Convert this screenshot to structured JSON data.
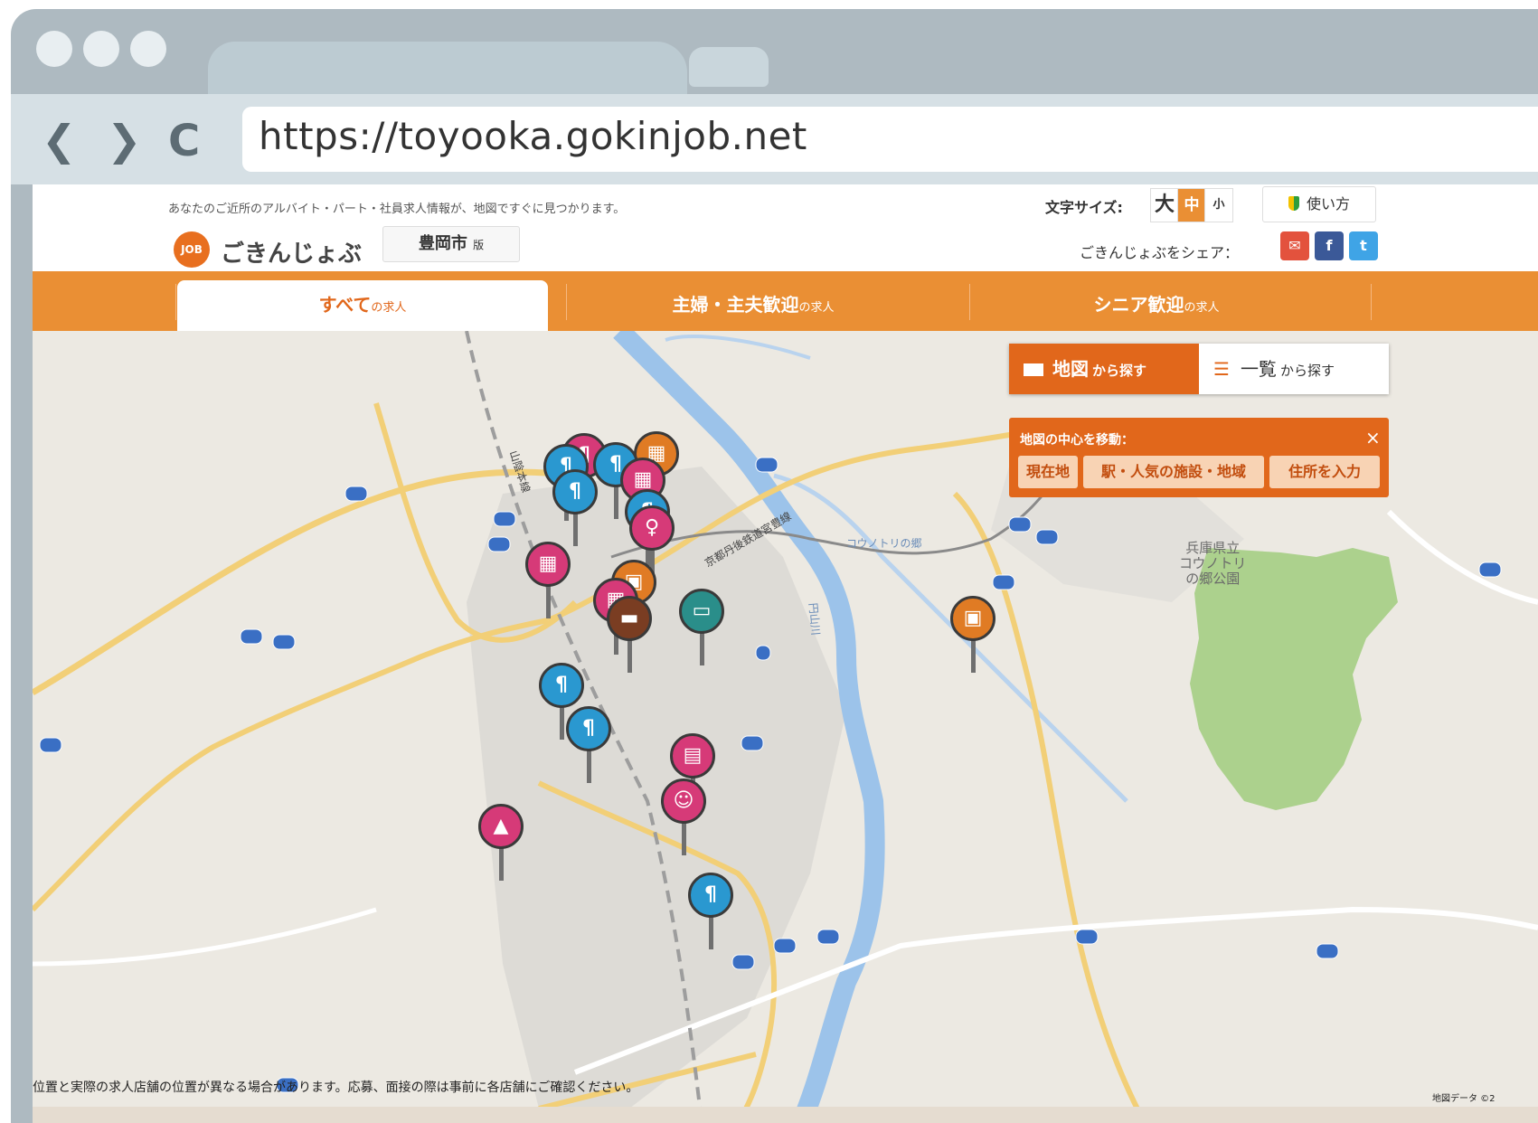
{
  "browser": {
    "url": "https://toyooka.gokinjob.net",
    "back_glyph": "❮",
    "forward_glyph": "❯",
    "reload_glyph": "C"
  },
  "header": {
    "tagline": "あなたのご近所のアルバイト・パート・社員求人情報が、地図ですぐに見つかります。",
    "logo_badge": "JOB",
    "logo_text": "ごきんじょぶ",
    "city": "豊岡市",
    "city_suffix": "版",
    "fontsize_label": "文字サイズ:",
    "fontsize_options": [
      "大",
      "中",
      "小"
    ],
    "howto_label": "使い方",
    "share_label": "ごきんじょぶをシェア：",
    "share_buttons": [
      "✉",
      "f",
      "t"
    ]
  },
  "nav": {
    "tabs": [
      {
        "label": "すべて",
        "suffix": "の求人"
      },
      {
        "label": "主婦・主夫歓迎",
        "suffix": "の求人"
      },
      {
        "label": "シニア歓迎",
        "suffix": "の求人"
      }
    ]
  },
  "map": {
    "mode_map": "地図",
    "mode_map_suffix": "から探す",
    "mode_list": "一覧",
    "mode_list_suffix": "から探す",
    "center_title": "地図の中心を移動：",
    "center_close": "×",
    "center_buttons": [
      "現在地",
      "駅・人気の施設・地域",
      "住所を入力"
    ],
    "labels": {
      "park": "兵庫県立\nコウノトリ\nの郷公園",
      "line1": "山陰本線",
      "line2": "京都丹後鉄道宮豊線",
      "river": "円山川",
      "station": "コウノトリの郷"
    },
    "notice": "位置と実際の求人店舗の位置が異なる場合があります。応募、面接の際は事前に各店舗にご確認ください。",
    "credit": "地図データ ©2"
  },
  "colors": {
    "accent": "#ea8f34",
    "accent_dark": "#e1671b",
    "pin_blue": "#2a98d0",
    "pin_pink": "#d63a78",
    "pin_orange": "#e07b24",
    "pin_teal": "#2a8e8a",
    "pin_brown": "#7a3d22"
  }
}
